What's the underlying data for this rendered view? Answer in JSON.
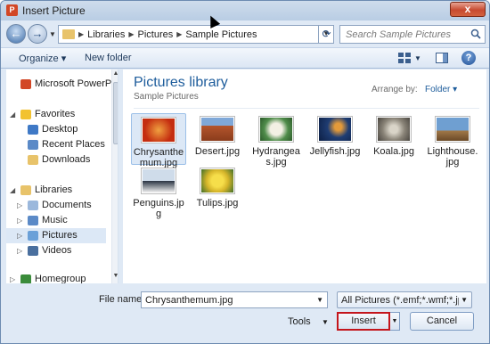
{
  "window": {
    "title": "Insert Picture",
    "close_label": "x"
  },
  "address": {
    "breadcrumb": [
      "Libraries",
      "Pictures",
      "Sample Pictures"
    ],
    "search_placeholder": "Search Sample Pictures"
  },
  "toolbar": {
    "organize": "Organize ▾",
    "new_folder": "New folder"
  },
  "nav": {
    "items": [
      {
        "label": "Microsoft PowerPo",
        "icon": "powerpoint-icon",
        "color": "#d24726"
      },
      {
        "label": "Favorites",
        "icon": "star-icon",
        "color": "#f2c230"
      },
      {
        "label": "Desktop",
        "icon": "desktop-icon",
        "color": "#3f79c6"
      },
      {
        "label": "Recent Places",
        "icon": "recent-places-icon",
        "color": "#5b8ac7"
      },
      {
        "label": "Downloads",
        "icon": "downloads-icon",
        "color": "#e8c36a"
      },
      {
        "label": "Libraries",
        "icon": "library-icon",
        "color": "#e8c36a"
      },
      {
        "label": "Documents",
        "icon": "documents-icon",
        "color": "#9bb8dc"
      },
      {
        "label": "Music",
        "icon": "music-icon",
        "color": "#5b8ac7"
      },
      {
        "label": "Pictures",
        "icon": "pictures-icon",
        "color": "#6aa0d8"
      },
      {
        "label": "Videos",
        "icon": "videos-icon",
        "color": "#4a6f9e"
      },
      {
        "label": "Homegroup",
        "icon": "homegroup-icon",
        "color": "#3b8c3b"
      }
    ]
  },
  "content": {
    "title": "Pictures library",
    "subtitle": "Sample Pictures",
    "arrange_label": "Arrange by:",
    "arrange_value": "Folder ▾",
    "files": [
      {
        "name": "Chrysanthemum.jpg",
        "line1": "Chrysanthe",
        "line2": "mum.jpg",
        "color": "#d8401a",
        "selected": true
      },
      {
        "name": "Desert.jpg",
        "line1": "Desert.jpg",
        "line2": "",
        "color": "#b4552c"
      },
      {
        "name": "Hydrangeas.jpg",
        "line1": "Hydrangea",
        "line2": "s.jpg",
        "color": "#4f8c4a"
      },
      {
        "name": "Jellyfish.jpg",
        "line1": "Jellyfish.jpg",
        "line2": "",
        "color": "#1f3d73"
      },
      {
        "name": "Koala.jpg",
        "line1": "Koala.jpg",
        "line2": "",
        "color": "#8a8478"
      },
      {
        "name": "Lighthouse.jpg",
        "line1": "Lighthouse.",
        "line2": "jpg",
        "color": "#6f9fd1"
      },
      {
        "name": "Penguins.jpg",
        "line1": "Penguins.jp",
        "line2": "g",
        "color": "#c9d6e6"
      },
      {
        "name": "Tulips.jpg",
        "line1": "Tulips.jpg",
        "line2": "",
        "color": "#d6b52a"
      }
    ]
  },
  "footer": {
    "file_name_label": "File name:",
    "file_name_value": "Chrysanthemum.jpg",
    "file_type_value": "All Pictures (*.emf;*.wmf;*.jpg;*",
    "tools_label": "Tools",
    "insert_label": "Insert",
    "cancel_label": "Cancel"
  }
}
